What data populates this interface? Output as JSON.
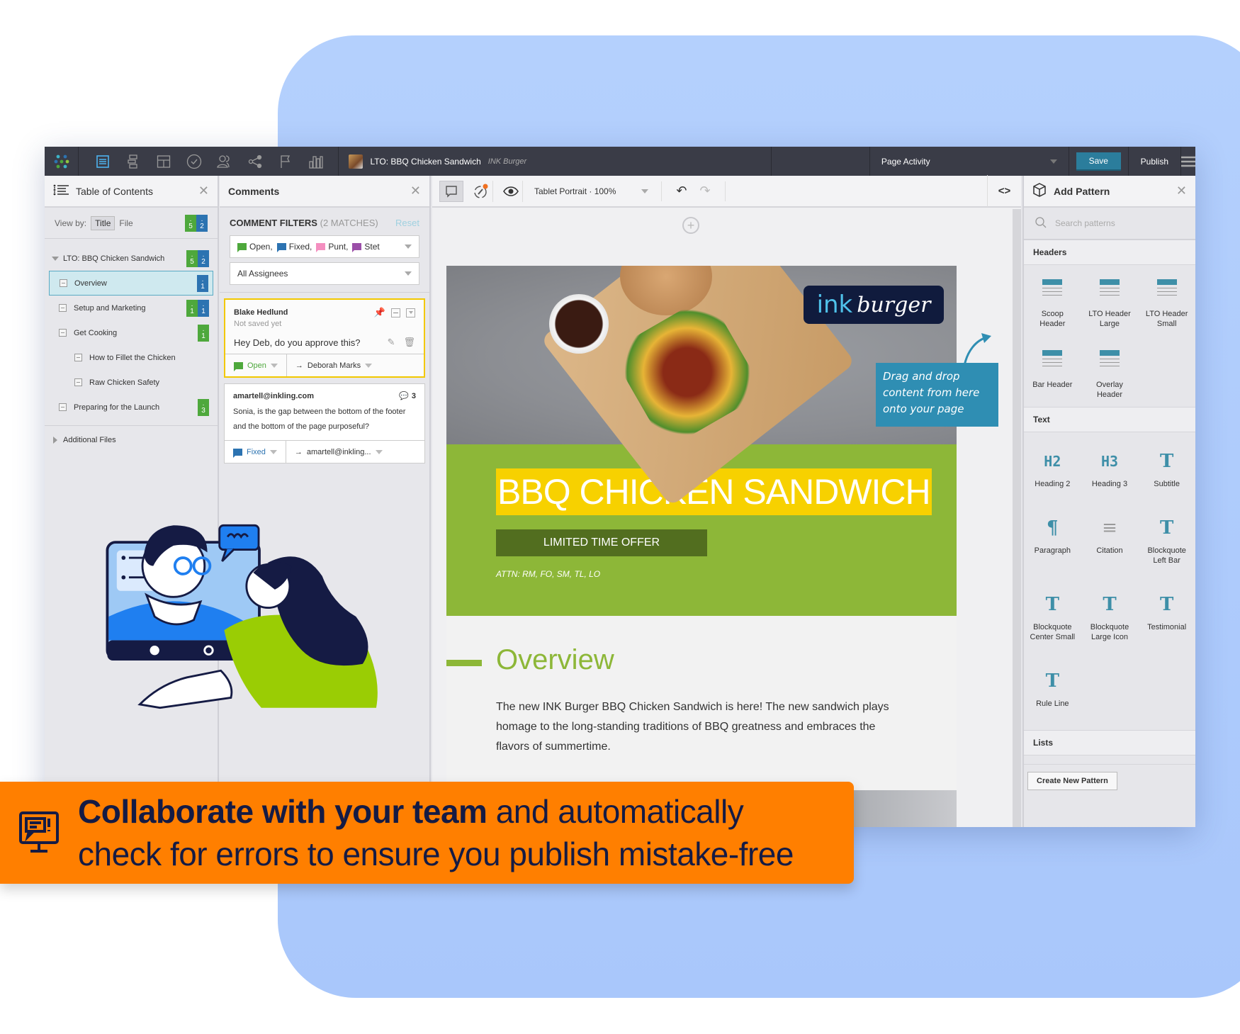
{
  "topbar": {
    "nav_icons": [
      "toc-icon",
      "structure-icon",
      "layout-icon",
      "check-icon",
      "users-icon",
      "share-icon",
      "flag-icon",
      "analytics-icon"
    ],
    "doc_title": "LTO: BBQ Chicken Sandwich",
    "doc_subtitle": "INK Burger",
    "activity_label": "Page Activity",
    "save_label": "Save",
    "publish_label": "Publish"
  },
  "toc": {
    "title": "Table of Contents",
    "view_by_label": "View by:",
    "view_title": "Title",
    "view_file": "File",
    "summary_badges": {
      "green": "5",
      "blue": "2"
    },
    "root": {
      "label": "LTO: BBQ Chicken Sandwich",
      "green": "5",
      "blue": "2"
    },
    "items": [
      {
        "label": "Overview",
        "level": 1,
        "selected": true,
        "green": "",
        "blue": "1"
      },
      {
        "label": "Setup and Marketing",
        "level": 1,
        "green": "1",
        "blue": "1"
      },
      {
        "label": "Get Cooking",
        "level": 1,
        "green": "1",
        "blue": ""
      },
      {
        "label": "How to Fillet the Chicken",
        "level": 2,
        "green": "",
        "blue": ""
      },
      {
        "label": "Raw Chicken Safety",
        "level": 2,
        "green": "",
        "blue": ""
      },
      {
        "label": "Preparing for the Launch",
        "level": 1,
        "green": "3",
        "blue": ""
      }
    ],
    "additional_files": "Additional Files"
  },
  "comments": {
    "title": "Comments",
    "filters_label": "COMMENT FILTERS",
    "matches": "(2 MATCHES)",
    "reset": "Reset",
    "status_filters": [
      {
        "label": "Open,",
        "color": "#4ea83c"
      },
      {
        "label": "Fixed,",
        "color": "#2c73b1"
      },
      {
        "label": "Punt,",
        "color": "#f48fc0"
      },
      {
        "label": "Stet",
        "color": "#9b4fa8"
      }
    ],
    "assignee_filter": "All Assignees",
    "cards": [
      {
        "author": "Blake Hedlund",
        "meta": "Not saved yet",
        "text": "Hey Deb, do you approve this?",
        "status": "Open",
        "status_color": "#4ea83c",
        "assignee": "Deborah Marks"
      },
      {
        "author": "amartell@inkling.com",
        "reply_count": "3",
        "text": "Sonia, is the gap between the bottom of the footer and the bottom of the page purposeful?",
        "status": "Fixed",
        "status_color": "#2c73b1",
        "assignee": "amartell@inkling..."
      }
    ]
  },
  "canvas": {
    "device_zoom": "Tablet Portrait · 100%",
    "code_toggle": "<>",
    "page": {
      "logo_ink": "ink",
      "logo_burger": "burger",
      "title": "BBQ CHICKEN SANDWICH",
      "badge": "LIMITED TIME OFFER",
      "attn": "ATTN: RM, FO, SM, TL, LO",
      "section_heading": "Overview",
      "paragraph": "The new INK Burger BBQ Chicken Sandwich is here! The new sandwich plays homage to the long-standing traditions of BBQ greatness and embraces the flavors of summertime."
    }
  },
  "tooltip": "Drag and drop content from here onto your page",
  "patterns": {
    "title": "Add Pattern",
    "search_placeholder": "Search patterns",
    "headers_label": "Headers",
    "headers": [
      "Scoop Header",
      "LTO Header Large",
      "LTO Header Small",
      "Bar Header",
      "Overlay Header"
    ],
    "text_label": "Text",
    "text": [
      {
        "label": "Heading 2",
        "glyph": "H2"
      },
      {
        "label": "Heading 3",
        "glyph": "H3"
      },
      {
        "label": "Subtitle",
        "glyph": "T"
      },
      {
        "label": "Paragraph",
        "glyph": "¶"
      },
      {
        "label": "Citation",
        "glyph": "≡"
      },
      {
        "label": "Blockquote Left Bar",
        "glyph": "T"
      },
      {
        "label": "Blockquote Center Small",
        "glyph": "T"
      },
      {
        "label": "Blockquote Large Icon",
        "glyph": "T"
      },
      {
        "label": "Testimonial",
        "glyph": "T"
      },
      {
        "label": "Rule Line",
        "glyph": "T"
      }
    ],
    "lists_label": "Lists",
    "create_label": "Create New Pattern"
  },
  "banner": {
    "bold": "Collaborate with your team",
    "rest_line1": " and automatically",
    "line2": "check for errors to ensure you publish mistake-free"
  }
}
